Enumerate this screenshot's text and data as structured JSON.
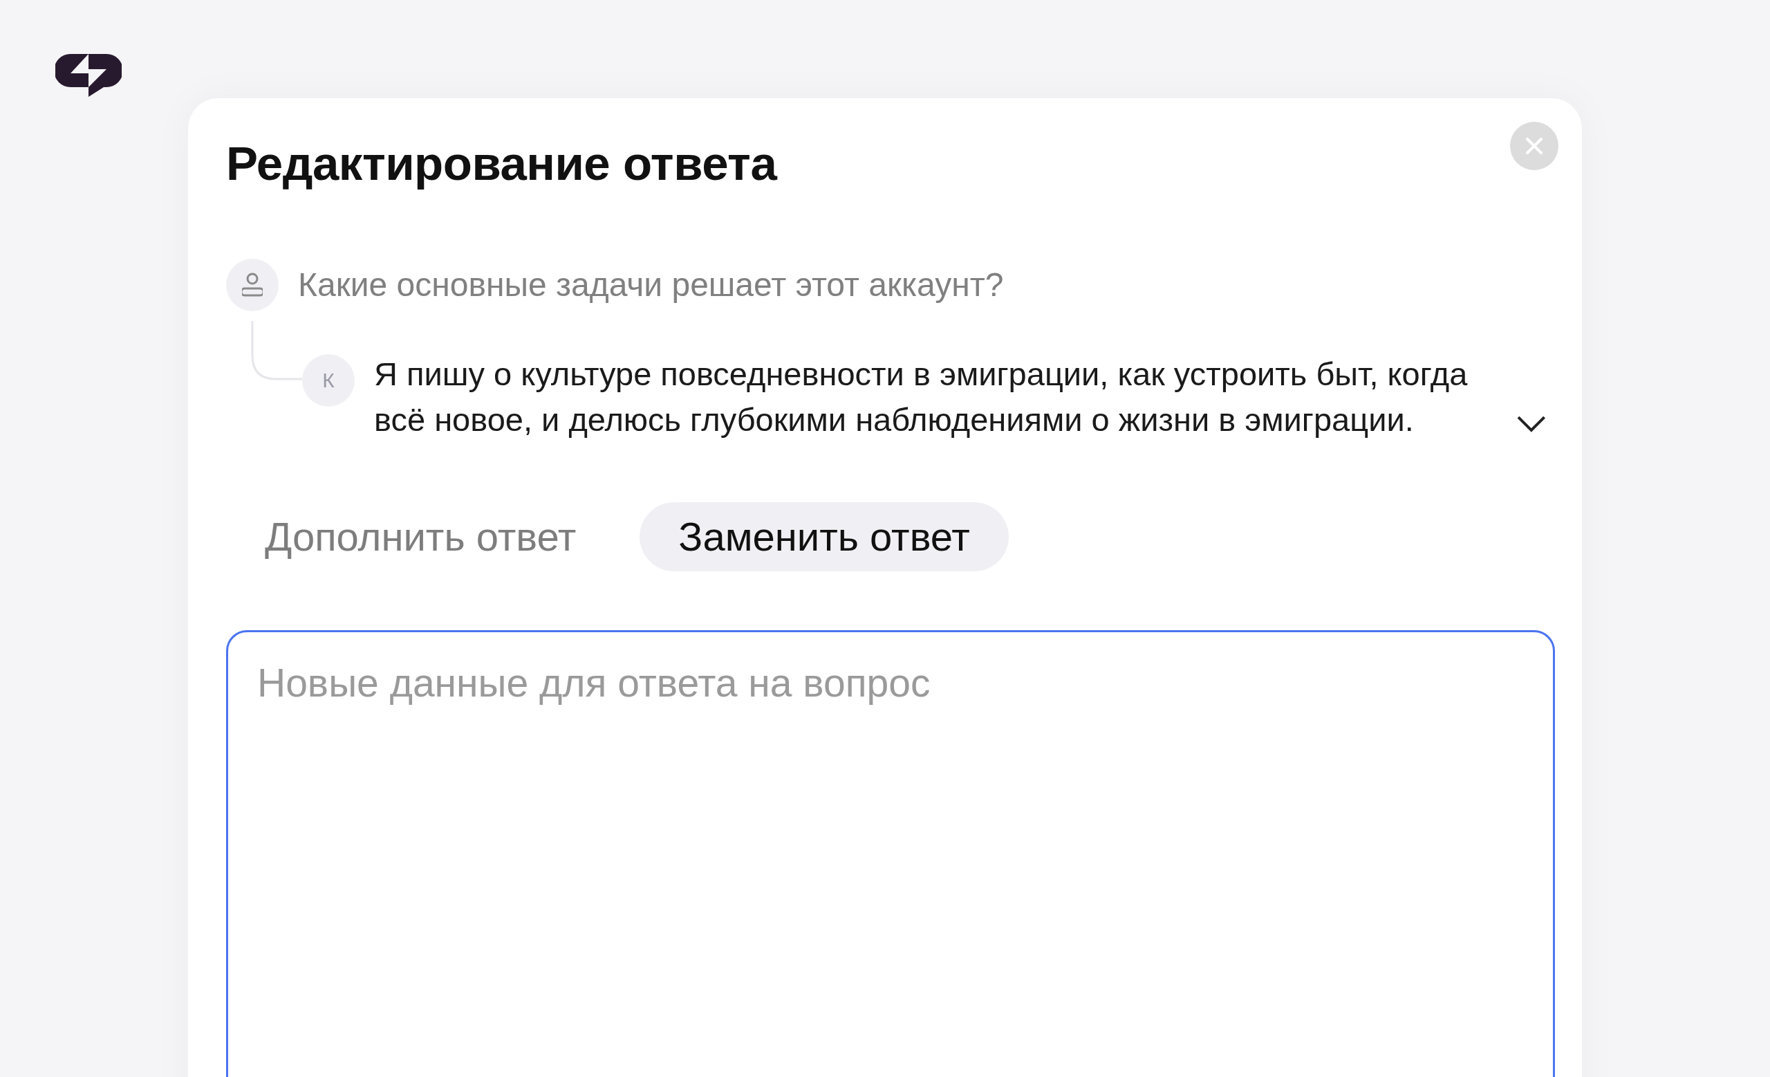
{
  "dialog": {
    "title": "Редактирование ответа"
  },
  "question": {
    "text": "Какие основные задачи решает этот аккаунт?"
  },
  "answer": {
    "avatar_letter": "К",
    "text": "Я пишу о культуре повседневности в эмиграции, как устроить быт, когда всё новое, и делюсь глубокими наблюдениями о жизни в эмиграции.",
    "expanded": false
  },
  "modes": [
    {
      "label": "Дополнить ответ",
      "selected": false
    },
    {
      "label": "Заменить ответ",
      "selected": true
    }
  ],
  "input": {
    "placeholder": "Новые данные для ответа на вопрос",
    "focused": true
  }
}
